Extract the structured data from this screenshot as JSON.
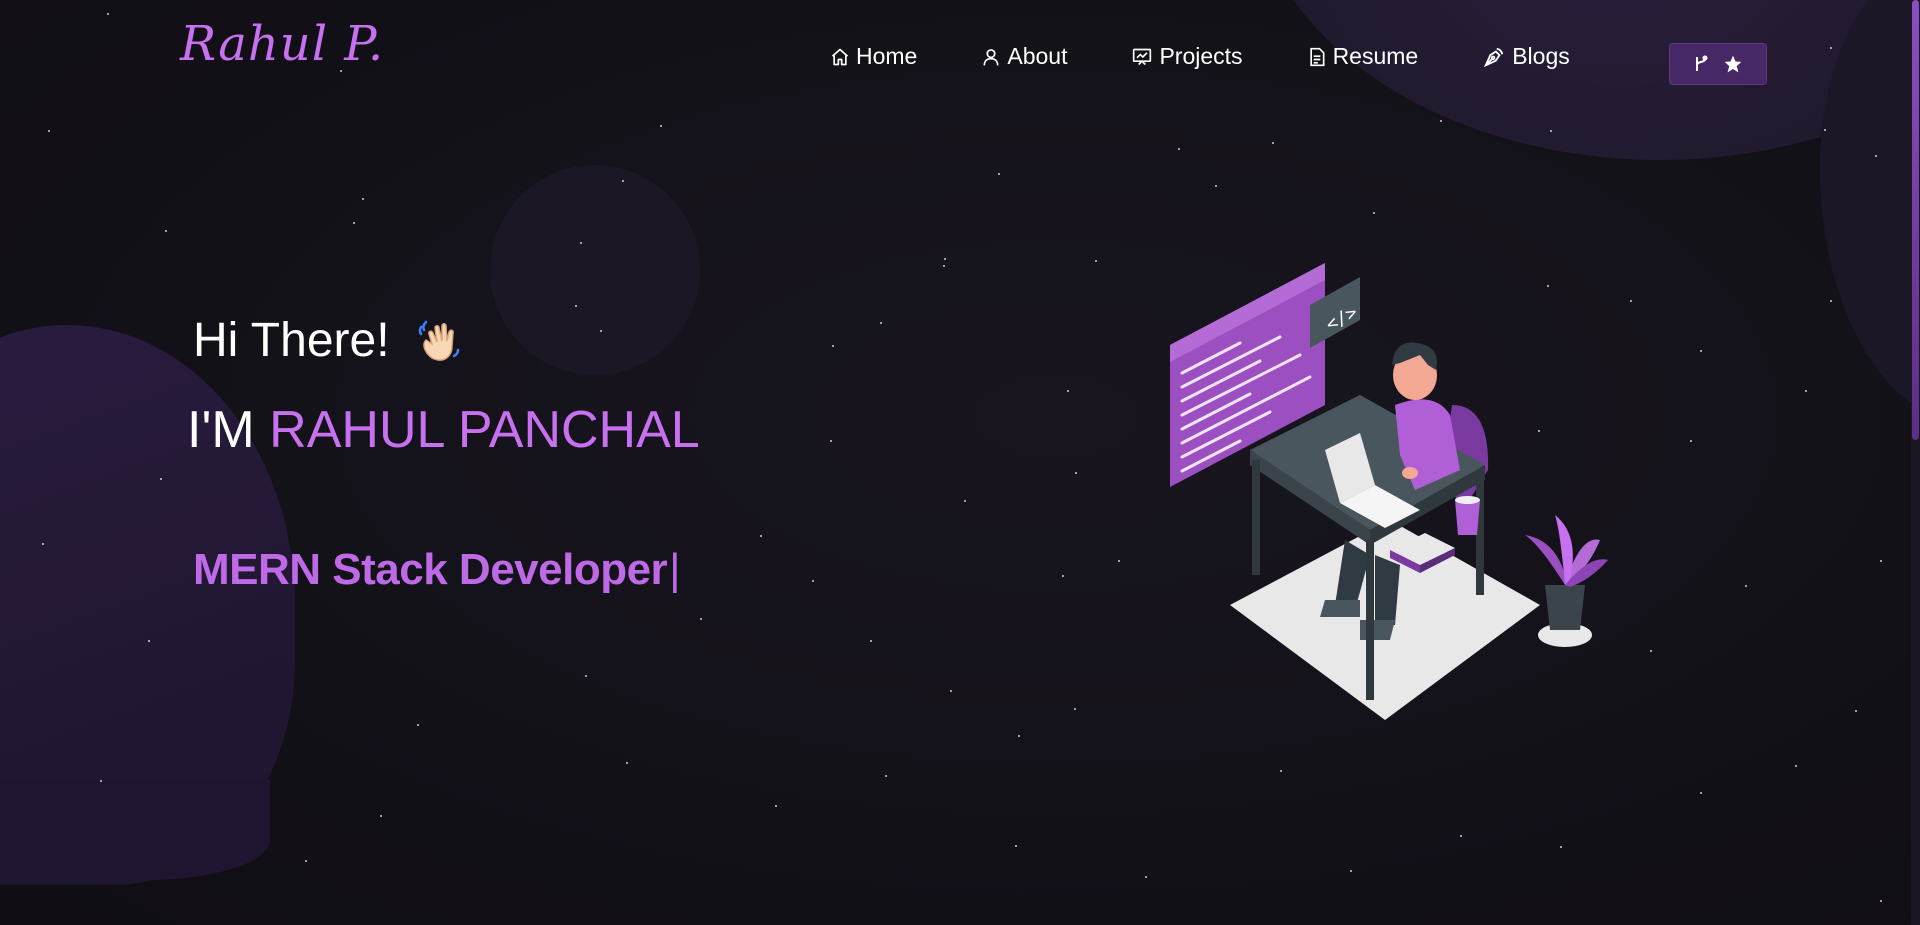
{
  "brand": {
    "logo_text": "Rahul P."
  },
  "nav": {
    "items": [
      {
        "label": "Home",
        "icon": "home-icon"
      },
      {
        "label": "About",
        "icon": "user-icon"
      },
      {
        "label": "Projects",
        "icon": "projects-icon"
      },
      {
        "label": "Resume",
        "icon": "document-icon"
      },
      {
        "label": "Blogs",
        "icon": "pen-nib-icon"
      }
    ],
    "github_button": {
      "icons": [
        "git-fork-icon",
        "star-icon"
      ]
    }
  },
  "hero": {
    "greeting": "Hi There!",
    "greeting_icon": "waving-hand-icon",
    "name_prefix": "I'M",
    "name": "RAHUL PANCHAL",
    "role": "MERN Stack Developer",
    "cursor": "|",
    "illustration": "developer-at-desk-illustration"
  },
  "theme": {
    "background": "#131118",
    "accent": "#c770f0",
    "button_bg": "#452865"
  }
}
